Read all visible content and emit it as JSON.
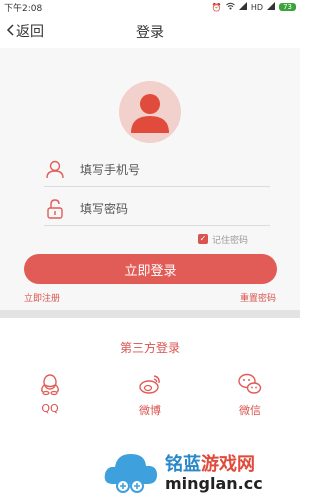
{
  "status_bar": {
    "time": "下午2:08",
    "network": "HD",
    "battery": "73"
  },
  "nav": {
    "back_label": "返回",
    "title": "登录"
  },
  "form": {
    "phone_placeholder": "填写手机号",
    "password_placeholder": "填写密码",
    "remember_label": "记住密码",
    "remember_checked": true,
    "login_button": "立即登录",
    "register_link": "立即注册",
    "reset_link": "重置密码"
  },
  "third_party": {
    "title": "第三方登录",
    "items": [
      {
        "label": "QQ",
        "icon": "qq-icon"
      },
      {
        "label": "微博",
        "icon": "weibo-icon"
      },
      {
        "label": "微信",
        "icon": "wechat-icon"
      }
    ]
  },
  "watermark": {
    "brand_part1": "铭蓝",
    "brand_part2": "游戏网",
    "domain": "minglan.cc"
  },
  "colors": {
    "accent": "#e15c57",
    "link": "#d9534f",
    "avatar_bg": "#f2d0cc"
  }
}
